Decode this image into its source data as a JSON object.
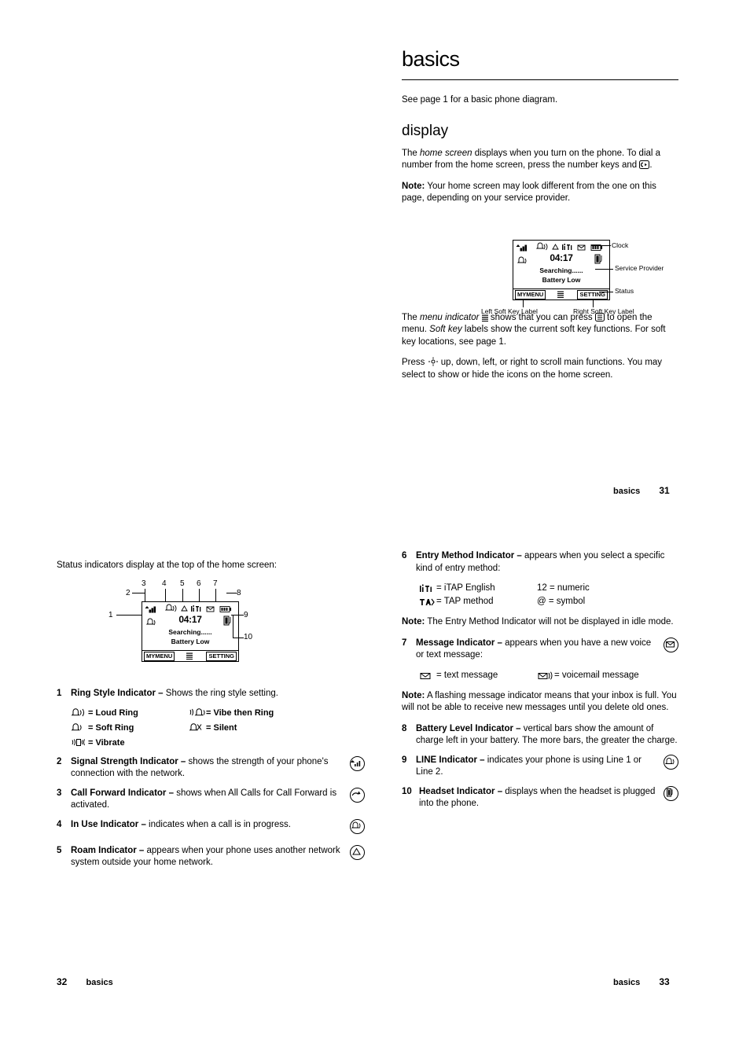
{
  "page31": {
    "title": "basics",
    "intro": "See page 1 for a basic phone diagram.",
    "section_title": "display",
    "para1_a": "The ",
    "para1_i": "home screen",
    "para1_b": " displays when you turn on the phone. To dial a number from the home screen, press the number keys and ",
    "para1_c": ".",
    "note_label": "Note:",
    "note_text": " Your home screen may look different from the one on this page, depending on your service provider.",
    "display_demo": {
      "clock": "04:17",
      "service_provider": "Searching......",
      "status": "Battery Low",
      "left_soft_key": "MYMENU",
      "right_soft_key": "SETTING",
      "callout_clock": "Clock",
      "callout_provider": "Service Provider",
      "callout_status": "Status",
      "callout_left": "Left Soft Key Label",
      "callout_right": "Right Soft Key Label"
    },
    "para2_a": "The ",
    "para2_i1": "menu indicator",
    "para2_b": " shows that you can press ",
    "para2_c": " to open the menu. ",
    "para2_i2": "Soft key",
    "para2_d": " labels show the current soft key functions. For soft key locations, see page 1.",
    "para3_a": "Press ",
    "para3_b": " up, down, left, or right to scroll main functions. You may select to show or hide the icons on the home screen.",
    "footer_name": "basics",
    "footer_page": "31"
  },
  "page32": {
    "intro": "Status indicators display at the top of the home screen:",
    "diagram": {
      "clock": "04:17",
      "provider": "Searching......",
      "status": "Battery Low",
      "left_soft_key": "MYMENU",
      "right_soft_key": "SETTING",
      "labels": [
        "1",
        "2",
        "3",
        "4",
        "5",
        "6",
        "7",
        "8",
        "9",
        "10"
      ]
    },
    "items": [
      {
        "num": "1",
        "label": "Ring Style Indicator –",
        "text": " Shows the ring style setting."
      },
      {
        "num": "2",
        "label": "Signal Strength Indicator –",
        "text": " shows the strength of your phone's connection with the network."
      },
      {
        "num": "3",
        "label": "Call Forward Indicator –",
        "text": " shows when All Calls for Call Forward is activated."
      },
      {
        "num": "4",
        "label": "In Use Indicator –",
        "text": " indicates when a call is in progress."
      },
      {
        "num": "5",
        "label": "Roam Indicator –",
        "text": " appears when your phone uses another network system outside your home network."
      }
    ],
    "ring_styles": [
      {
        "left": "= Loud Ring",
        "right": "= Vibe then Ring"
      },
      {
        "left": "= Soft Ring",
        "right": "= Silent"
      },
      {
        "left": "= Vibrate",
        "right": ""
      }
    ],
    "footer_name": "basics",
    "footer_page": "32"
  },
  "page33": {
    "items6": {
      "num": "6",
      "label": "Entry Method Indicator –",
      "text": " appears when you select a specific kind of entry method:"
    },
    "entry_methods": [
      {
        "left": "= iTAP English",
        "right": "12 = numeric"
      },
      {
        "left": "= TAP method",
        "right": "@ = symbol"
      }
    ],
    "note1_label": "Note:",
    "note1_text": " The Entry Method Indicator will not be displayed in idle mode.",
    "items7": {
      "num": "7",
      "label": "Message Indicator –",
      "text": " appears when you have a new voice or text message:"
    },
    "message_types": [
      {
        "left": "= text message",
        "right": "= voicemail message"
      }
    ],
    "note2_label": "Note:",
    "note2_text": " A flashing message indicator means that your inbox is full. You will not be able to receive new messages until you delete old ones.",
    "items8": {
      "num": "8",
      "label": "Battery Level Indicator –",
      "text": " vertical bars show the amount of charge left in your battery. The more bars, the greater the charge."
    },
    "items9": {
      "num": "9",
      "label": "LINE Indicator –",
      "text": " indicates your phone is using Line 1 or Line 2."
    },
    "items10": {
      "num": "10",
      "label": "Headset Indicator –",
      "text": " displays when the headset is plugged into the phone."
    },
    "footer_name": "basics",
    "footer_page": "33"
  }
}
